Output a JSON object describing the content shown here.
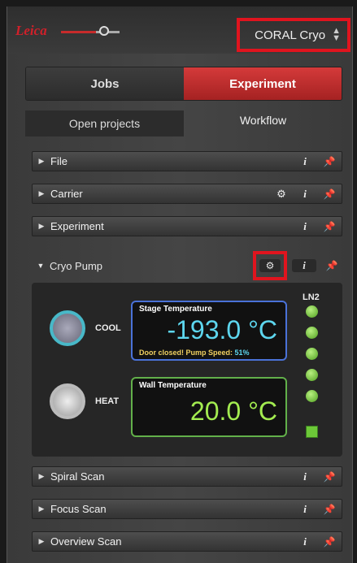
{
  "header": {
    "logo": "Leica",
    "instrument": "CORAL Cryo"
  },
  "main_tabs": [
    {
      "label": "Jobs"
    },
    {
      "label": "Experiment"
    }
  ],
  "sub_tabs": [
    {
      "label": "Open projects"
    },
    {
      "label": "Workflow"
    }
  ],
  "sections": [
    {
      "label": "File"
    },
    {
      "label": "Carrier"
    },
    {
      "label": "Experiment"
    },
    {
      "label": "Cryo Pump"
    },
    {
      "label": "Spiral Scan"
    },
    {
      "label": "Focus Scan"
    },
    {
      "label": "Overview Scan"
    }
  ],
  "info_glyph": "i",
  "cryo_pump": {
    "cool_label": "COOL",
    "heat_label": "HEAT",
    "stage": {
      "title": "Stage Temperature",
      "value": "-193.0 °C",
      "status": "Door closed! Pump Speed:",
      "pump_speed": "51%"
    },
    "wall": {
      "title": "Wall Temperature",
      "value": "20.0 °C"
    },
    "ln2_label": "LN2",
    "ln2_levels_lit": 6
  },
  "colors": {
    "accent_red": "#d43a3a",
    "highlight_red": "#e0141e",
    "stage_blue": "#5dd6ee",
    "wall_green": "#a3ec50"
  }
}
